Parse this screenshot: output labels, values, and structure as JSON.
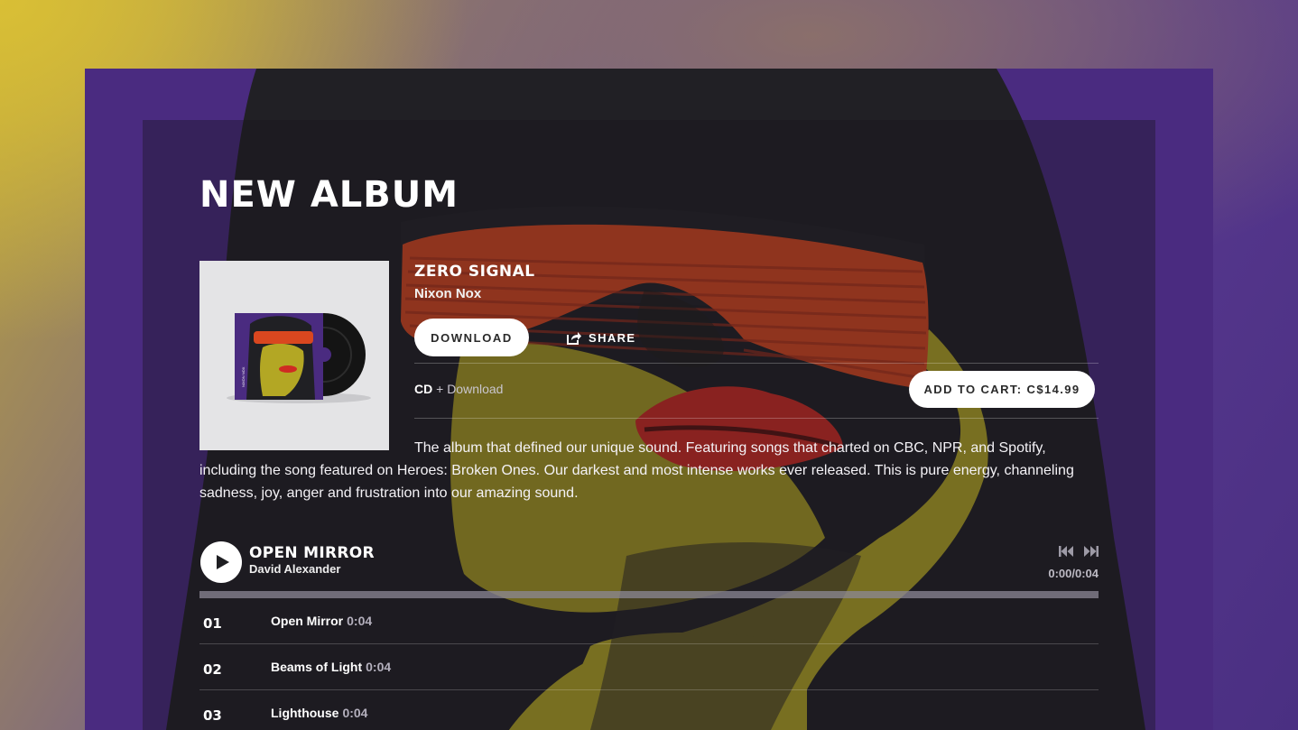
{
  "section_title": "NEW ALBUM",
  "album": {
    "title": "ZERO SIGNAL",
    "artist": "Nixon Nox",
    "download_label": "DOWNLOAD",
    "share_label": "SHARE",
    "format_bold": "CD",
    "format_extra": "+ Download",
    "cart_label": "ADD TO CART: C$14.99",
    "cover_text": "NIXON NOX",
    "description": "The album that defined our unique sound. Featuring songs that charted on CBC, NPR, and Spotify, including the song featured on Heroes: Broken Ones. Our darkest and most intense works ever released. This is pure energy, channeling sadness, joy, anger and frustration into our amazing sound."
  },
  "player": {
    "now_title": "OPEN MIRROR",
    "now_artist": "David Alexander",
    "time": "0:00/0:04",
    "progress": 0
  },
  "tracks": [
    {
      "num": "01",
      "title": "Open Mirror",
      "duration": "0:04"
    },
    {
      "num": "02",
      "title": "Beams of Light",
      "duration": "0:04"
    },
    {
      "num": "03",
      "title": "Lighthouse",
      "duration": "0:04"
    }
  ],
  "colors": {
    "frame_purple": "#4a2b80",
    "skin_yellow": "#b5a824",
    "glasses_red": "#d8471f",
    "lips_red": "#cc2a22",
    "hair_dark": "#202024"
  },
  "icons": [
    "share-icon",
    "play-icon",
    "previous-track-icon",
    "next-track-icon"
  ]
}
